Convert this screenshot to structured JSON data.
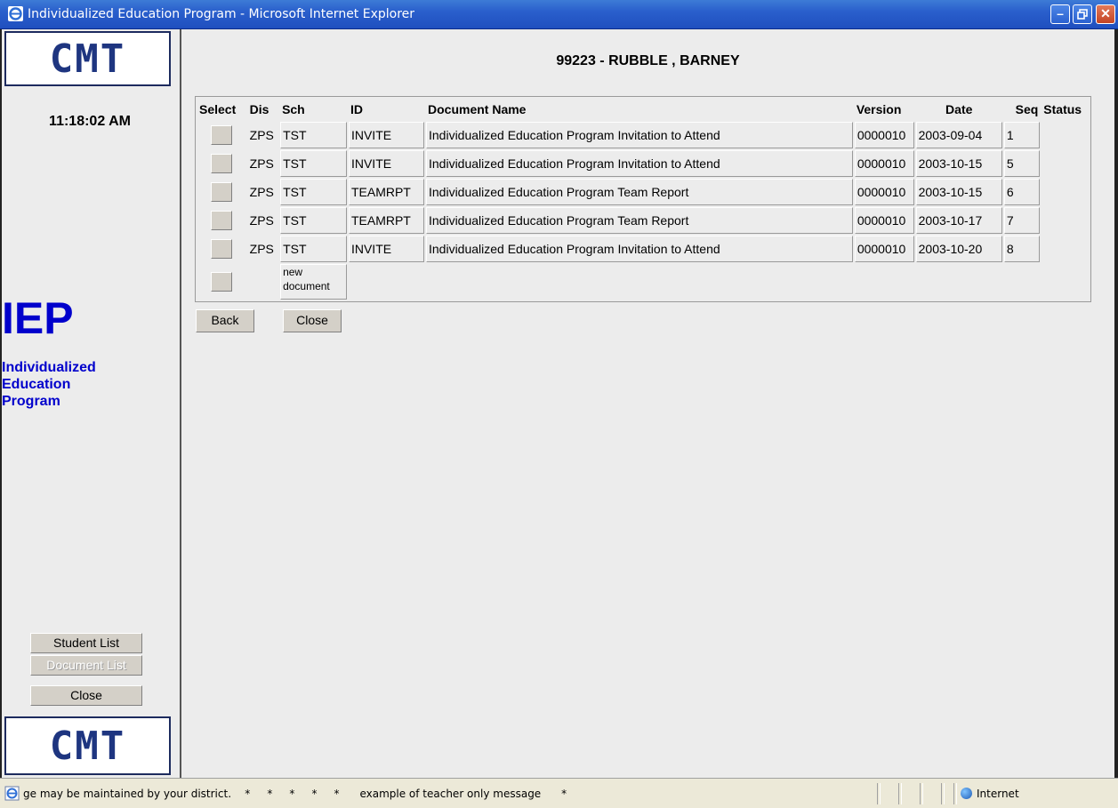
{
  "window": {
    "title": "Individualized Education Program - Microsoft Internet Explorer",
    "controls": [
      "minimize",
      "restore",
      "close"
    ]
  },
  "sidebar": {
    "logo_text": "CMT",
    "clock": "11:18:02 AM",
    "app_name": "IEP",
    "app_subtitle_lines": [
      "Individualized",
      "Education",
      "Program"
    ],
    "nav": {
      "student_list": "Student List",
      "document_list": "Document List",
      "close": "Close"
    }
  },
  "main": {
    "student_header": "99223 - RUBBLE , BARNEY",
    "table": {
      "columns": [
        "Select",
        "Dis",
        "Sch",
        "ID",
        "Document Name",
        "Version",
        "Date",
        "Seq",
        "Status"
      ],
      "rows": [
        {
          "dis": "ZPS",
          "sch": "TST",
          "id": "INVITE",
          "name": "Individualized Education Program Invitation to Attend",
          "version": "0000010",
          "date": "2003-09-04",
          "seq": "1",
          "status": ""
        },
        {
          "dis": "ZPS",
          "sch": "TST",
          "id": "INVITE",
          "name": "Individualized Education Program Invitation to Attend",
          "version": "0000010",
          "date": "2003-10-15",
          "seq": "5",
          "status": ""
        },
        {
          "dis": "ZPS",
          "sch": "TST",
          "id": "TEAMRPT",
          "name": "Individualized Education Program Team Report",
          "version": "0000010",
          "date": "2003-10-15",
          "seq": "6",
          "status": ""
        },
        {
          "dis": "ZPS",
          "sch": "TST",
          "id": "TEAMRPT",
          "name": "Individualized Education Program Team Report",
          "version": "0000010",
          "date": "2003-10-17",
          "seq": "7",
          "status": ""
        },
        {
          "dis": "ZPS",
          "sch": "TST",
          "id": "INVITE",
          "name": "Individualized Education Program Invitation to Attend",
          "version": "0000010",
          "date": "2003-10-20",
          "seq": "8",
          "status": ""
        }
      ],
      "new_document_label": "new document"
    },
    "buttons": {
      "back": "Back",
      "close": "Close"
    }
  },
  "statusbar": {
    "message": "ge may be maintained by your district.    *     *     *     *     *      example of teacher only message      *",
    "zone": "Internet"
  }
}
